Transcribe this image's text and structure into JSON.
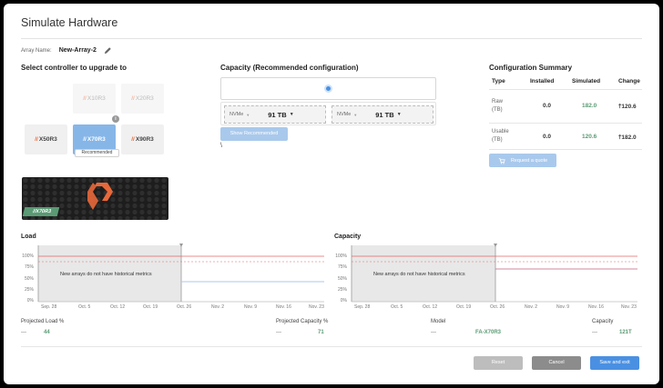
{
  "dialog": {
    "title": "Simulate Hardware"
  },
  "array": {
    "label": "Array Name:",
    "value": "New-Array-2"
  },
  "controllers": {
    "heading": "Select controller to upgrade to",
    "tiles": [
      {
        "name": "X50R3",
        "state": "normal"
      },
      {
        "name": "X70R3",
        "state": "selected"
      },
      {
        "name": "X90R3",
        "state": "normal"
      },
      {
        "name": "X10R3",
        "state": "disabled"
      },
      {
        "name": "X20R3",
        "state": "disabled"
      }
    ],
    "slash": "//",
    "recommended_label": "Recommended",
    "info": "i",
    "hardware_tag": "//X70R3"
  },
  "capacity_config": {
    "heading": "Capacity (Recommended configuration)",
    "drives": [
      {
        "type": "NVMe",
        "size": "91 TB"
      },
      {
        "type": "NVMe",
        "size": "91 TB"
      }
    ],
    "show_recommended": "Show Recommended",
    "stray": "\\"
  },
  "summary": {
    "heading": "Configuration Summary",
    "columns": [
      "Type",
      "Installed",
      "Simulated",
      "Change"
    ],
    "rows": [
      {
        "type_line1": "Raw",
        "type_line2": "(TB)",
        "installed": "0.0",
        "simulated": "182.0",
        "change": "120.6"
      },
      {
        "type_line1": "Usable",
        "type_line2": "(TB)",
        "installed": "0.0",
        "simulated": "120.6",
        "change": "182.0"
      }
    ],
    "quote_button": "Request a quote"
  },
  "charts": {
    "load": {
      "title": "Load",
      "note": "New arrays do not have historical metrics",
      "yticks": [
        "100%",
        "75%",
        "50%",
        "25%",
        "0%"
      ],
      "xticks": [
        "Sep. 28",
        "Oct. 5",
        "Oct. 12",
        "Oct. 19",
        "Oct. 26",
        "Nov. 2",
        "Nov. 9",
        "Nov. 16",
        "Nov. 23"
      ]
    },
    "capacity": {
      "title": "Capacity",
      "note": "New arrays do not have historical metrics",
      "yticks": [
        "100%",
        "75%",
        "50%",
        "25%",
        "0%"
      ],
      "xticks": [
        "Sep. 28",
        "Oct. 5",
        "Oct. 12",
        "Oct. 19",
        "Oct. 26",
        "Nov. 2",
        "Nov. 9",
        "Nov. 16",
        "Nov. 23"
      ]
    },
    "colors": {
      "threshold": "#e06666",
      "projection": "#a9c9ec",
      "shade": "#e8e8e8"
    }
  },
  "metrics": {
    "projected_load_label": "Projected Load %",
    "projected_load_current": "—",
    "projected_load_value": "44",
    "projected_capacity_label": "Projected Capacity %",
    "projected_capacity_current": "—",
    "projected_capacity_value": "71",
    "model_label": "Model",
    "model_current": "—",
    "model_value": "FA-X70R3",
    "capacity_label": "Capacity",
    "capacity_current": "—",
    "capacity_value": "121T"
  },
  "footer": {
    "reset": "Reset",
    "cancel": "Cancel",
    "save": "Save and exit"
  }
}
